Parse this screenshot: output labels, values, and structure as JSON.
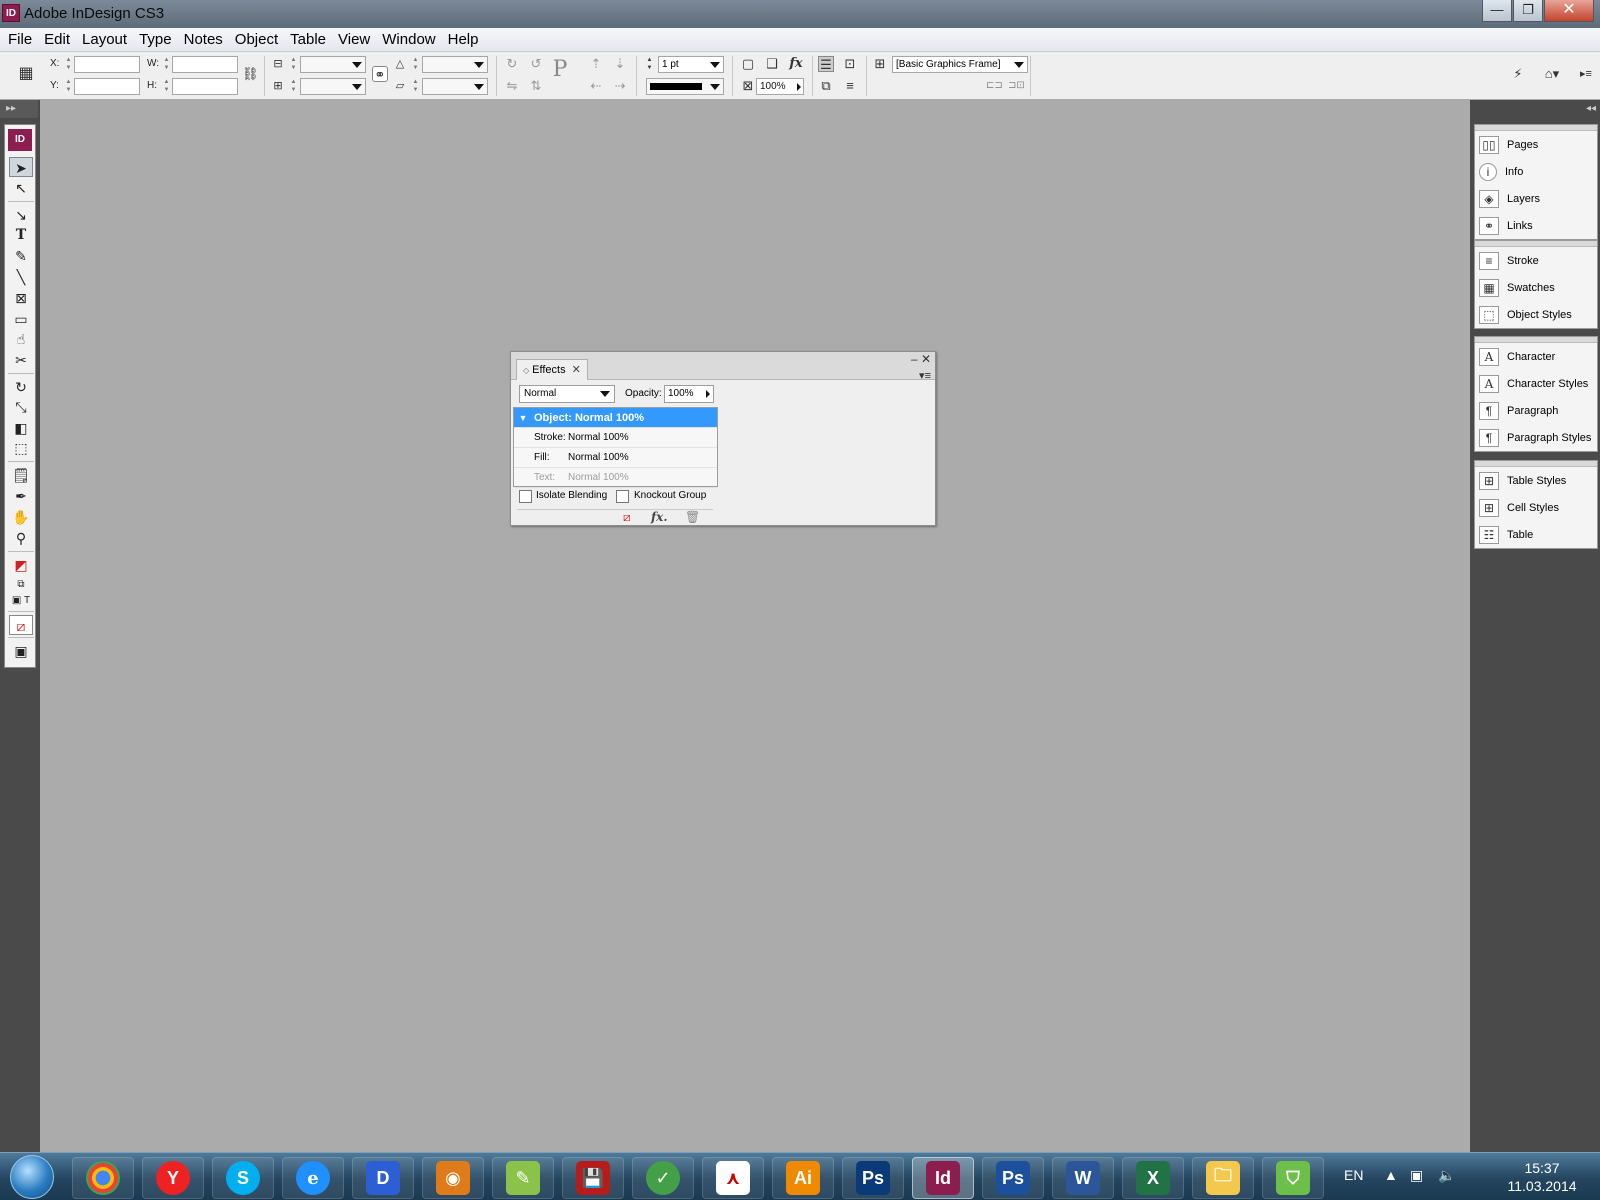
{
  "window": {
    "title": "Adobe InDesign CS3",
    "app_icon": "ID"
  },
  "menubar": [
    "File",
    "Edit",
    "Layout",
    "Type",
    "Notes",
    "Object",
    "Table",
    "View",
    "Window",
    "Help"
  ],
  "control_panel": {
    "x_label": "X:",
    "y_label": "Y:",
    "w_label": "W:",
    "h_label": "H:",
    "stroke_weight": "1 pt",
    "opacity": "100%",
    "object_style": "[Basic Graphics Frame]"
  },
  "toolbox": {
    "logo": "ID"
  },
  "panels": {
    "group1": [
      "Pages",
      "Info",
      "Layers",
      "Links"
    ],
    "group2": [
      "Stroke",
      "Swatches",
      "Object Styles"
    ],
    "group3": [
      "Character",
      "Character Styles",
      "Paragraph",
      "Paragraph Styles"
    ],
    "group4": [
      "Table Styles",
      "Cell Styles",
      "Table"
    ]
  },
  "effects": {
    "tab": "Effects",
    "blend_mode": "Normal",
    "opacity_label": "Opacity:",
    "opacity_value": "100%",
    "rows": [
      {
        "label": "Object:",
        "value": "Normal 100%"
      },
      {
        "label": "Stroke:",
        "value": "Normal 100%"
      },
      {
        "label": "Fill:",
        "value": "Normal 100%"
      },
      {
        "label": "Text:",
        "value": "Normal 100%"
      }
    ],
    "isolate_blending": "Isolate Blending",
    "knockout_group": "Knockout Group"
  },
  "taskbar": {
    "apps": [
      "Chrome",
      "Yandex",
      "Skype",
      "Internet Explorer",
      "D",
      "Viewer",
      "Green",
      "Floppy",
      "Evernote",
      "Adobe Reader",
      "Ai",
      "Ps",
      "Id",
      "Ps",
      "W",
      "Excel",
      "Folder",
      "Shop"
    ],
    "language": "EN",
    "time": "15:37",
    "date": "11.03.2014"
  },
  "colors": {
    "selection_blue": "#3399ff",
    "indesign_brand": "#8b1d4f",
    "canvas": "#ababab"
  }
}
